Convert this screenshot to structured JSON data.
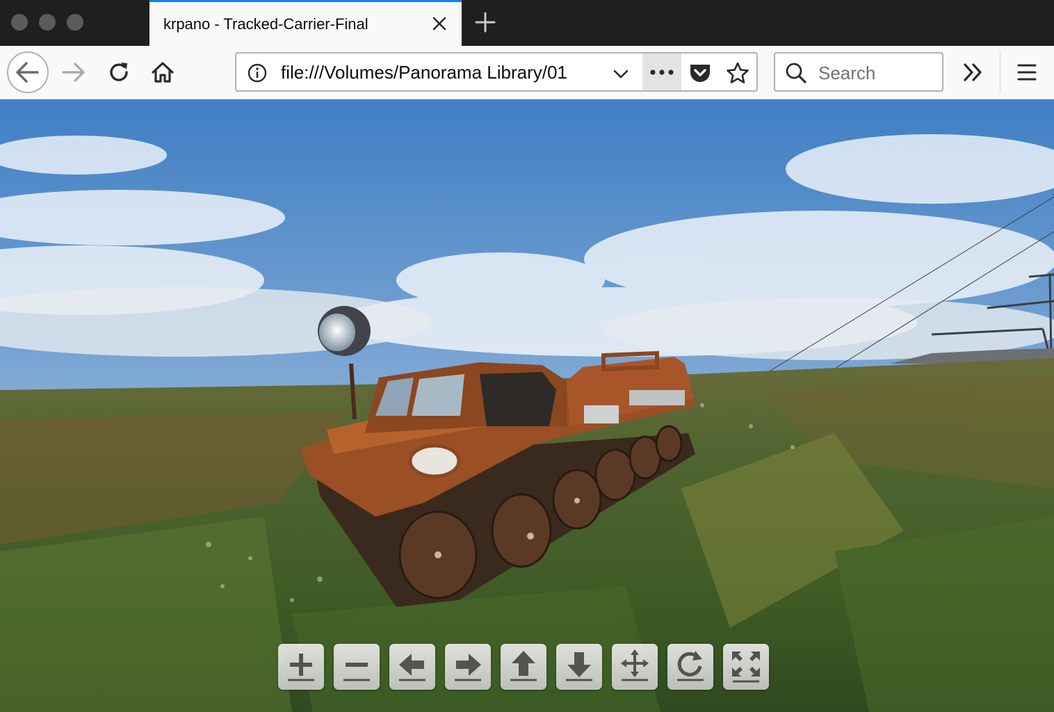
{
  "window": {
    "traffic_lights": [
      "close-light",
      "minimize-light",
      "zoom-light"
    ]
  },
  "tab": {
    "title": "krpano - Tracked-Carrier-Final",
    "accent_color": "#0a84ff"
  },
  "toolbar": {
    "back_icon": "arrow-left-icon",
    "forward_icon": "arrow-right-icon",
    "reload_icon": "reload-icon",
    "home_icon": "home-icon",
    "url": "file:///Volumes/Panorama Library/01",
    "page_actions_icon": "ellipsis-icon",
    "pocket_icon": "pocket-icon",
    "bookmark_icon": "star-icon",
    "search_placeholder": "Search",
    "overflow_icon": "double-chevron-icon",
    "menu_icon": "hamburger-icon"
  },
  "panorama": {
    "scene": "rusted tracked carrier vehicle in a green tundra field under a partly cloudy blue sky"
  },
  "krpano_controls": [
    {
      "name": "zoom-in",
      "icon": "plus-icon"
    },
    {
      "name": "zoom-out",
      "icon": "minus-icon"
    },
    {
      "name": "pan-left",
      "icon": "arrow-left-icon"
    },
    {
      "name": "pan-right",
      "icon": "arrow-right-icon"
    },
    {
      "name": "pan-up",
      "icon": "arrow-up-icon"
    },
    {
      "name": "pan-down",
      "icon": "arrow-down-icon"
    },
    {
      "name": "move-mode",
      "icon": "move-icon"
    },
    {
      "name": "auto-rotate",
      "icon": "rotate-icon"
    },
    {
      "name": "fullscreen",
      "icon": "fullscreen-icon"
    }
  ]
}
